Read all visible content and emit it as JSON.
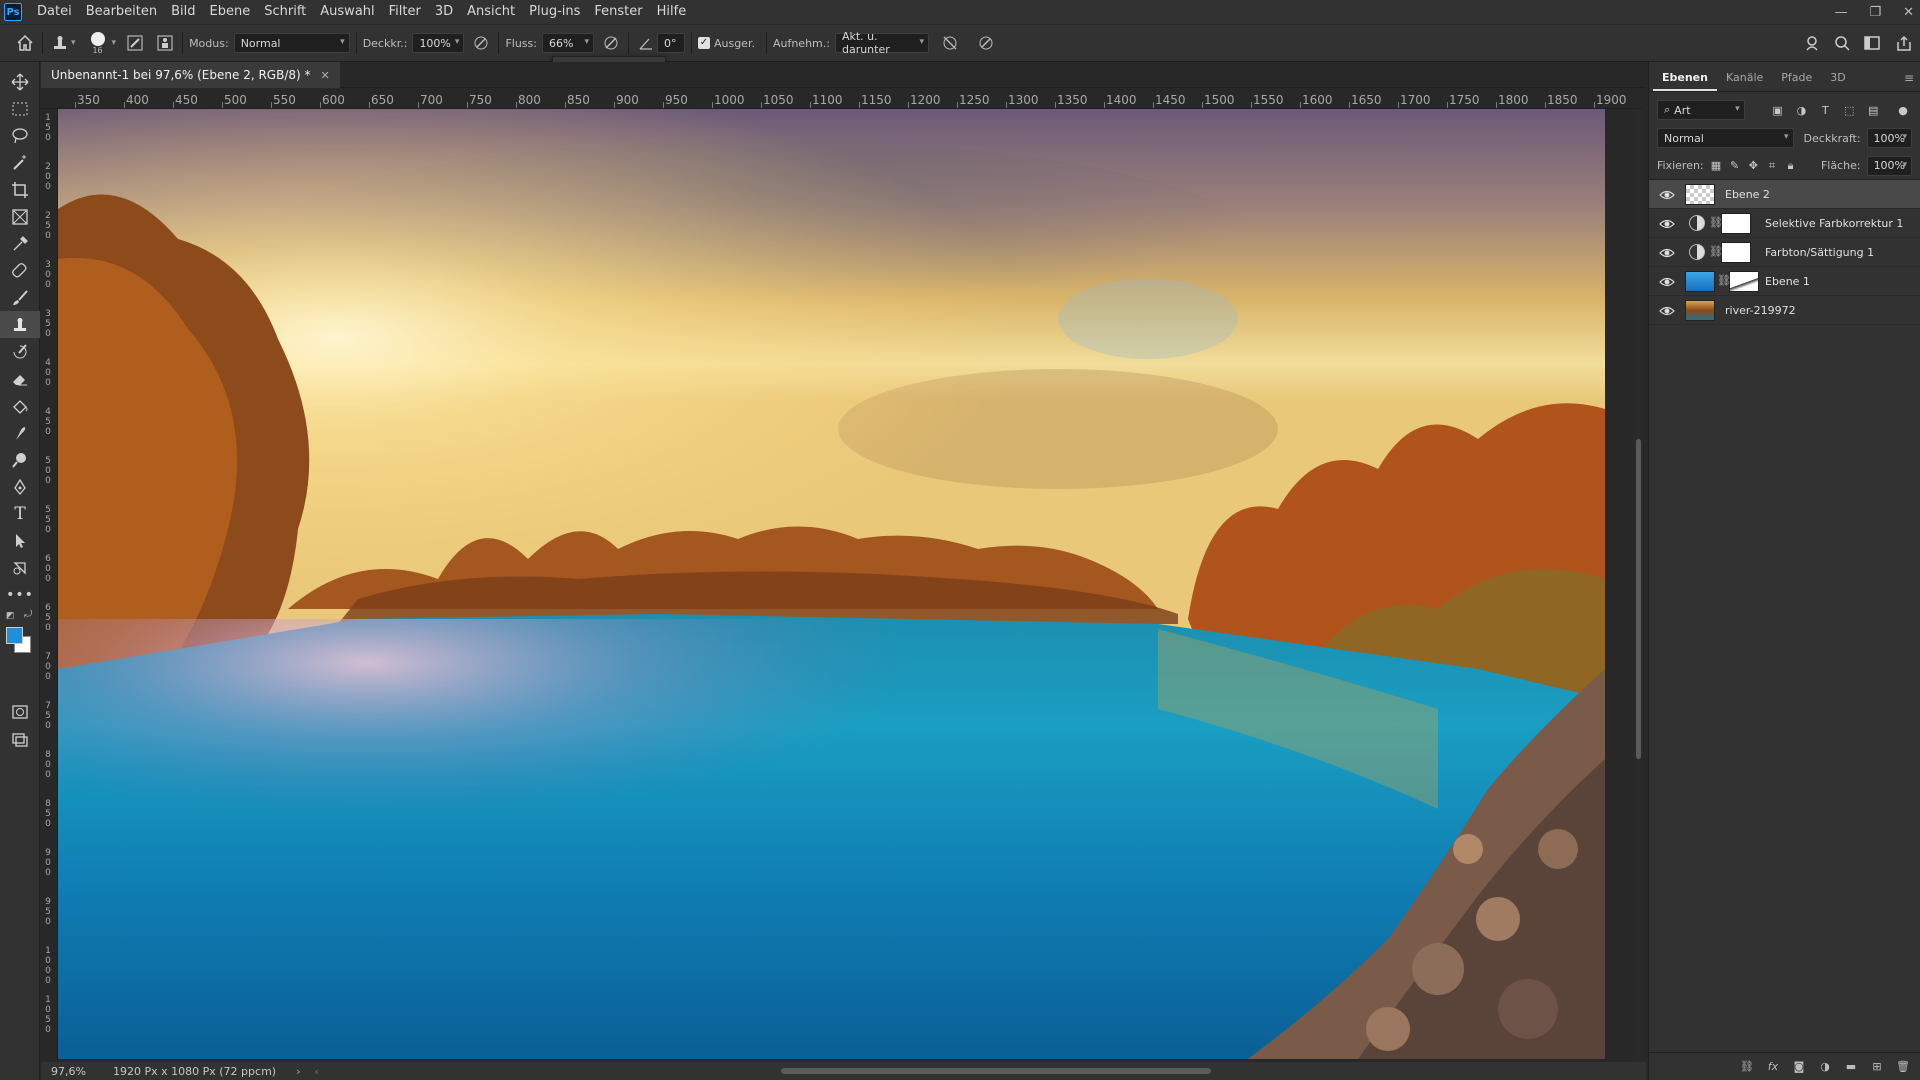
{
  "app": {
    "logo_text": "Ps"
  },
  "menu": [
    "Datei",
    "Bearbeiten",
    "Bild",
    "Ebene",
    "Schrift",
    "Auswahl",
    "Filter",
    "3D",
    "Ansicht",
    "Plug-ins",
    "Fenster",
    "Hilfe"
  ],
  "options": {
    "brush_size": "16",
    "mode_label": "Modus:",
    "mode_value": "Normal",
    "opacity_label": "Deckkr.:",
    "opacity_value": "100%",
    "flow_label": "Fluss:",
    "flow_value": "66%",
    "angle_value": "0°",
    "aligned_label": "Ausger.",
    "sample_label": "Aufnehm.:",
    "sample_value": "Akt. u. darunter",
    "flow_slider_fraction": 0.66
  },
  "document": {
    "tab_title": "Unbenannt-1 bei 97,6% (Ebene 2, RGB/8) *",
    "ruler_h": [
      "350",
      "400",
      "450",
      "500",
      "550",
      "600",
      "650",
      "700",
      "750",
      "800",
      "850",
      "900",
      "950",
      "1000",
      "1050",
      "1100",
      "1150",
      "1200",
      "1250",
      "1300",
      "1350",
      "1400",
      "1450",
      "1500",
      "1550",
      "1600",
      "1650",
      "1700",
      "1750",
      "1800",
      "1850",
      "1900"
    ],
    "ruler_v": [
      "150",
      "200",
      "250",
      "300",
      "350",
      "400",
      "450",
      "500",
      "550",
      "600",
      "650",
      "700",
      "750",
      "800",
      "850",
      "900",
      "950",
      "1000",
      "1050"
    ]
  },
  "status": {
    "zoom": "97,6%",
    "info": "1920 Px x 1080 Px (72 ppcm)"
  },
  "panel": {
    "tabs": [
      "Ebenen",
      "Kanäle",
      "Pfade",
      "3D"
    ],
    "filter_label": "Art",
    "blend_mode": "Normal",
    "opacity_label": "Deckkraft:",
    "opacity_value": "100%",
    "lock_label": "Fixieren:",
    "fill_label": "Fläche:",
    "fill_value": "100%",
    "layers": [
      {
        "name": "Ebene 2",
        "kind": "pixel",
        "selected": true
      },
      {
        "name": "Selektive Farbkorrektur 1",
        "kind": "adjustment"
      },
      {
        "name": "Farbton/Sättigung 1",
        "kind": "adjustment"
      },
      {
        "name": "Ebene 1",
        "kind": "masked"
      },
      {
        "name": "river-219972",
        "kind": "smart"
      }
    ]
  },
  "colors": {
    "foreground": "#1e8fd8",
    "background": "#ffffff",
    "accent": "#31a8ff"
  }
}
